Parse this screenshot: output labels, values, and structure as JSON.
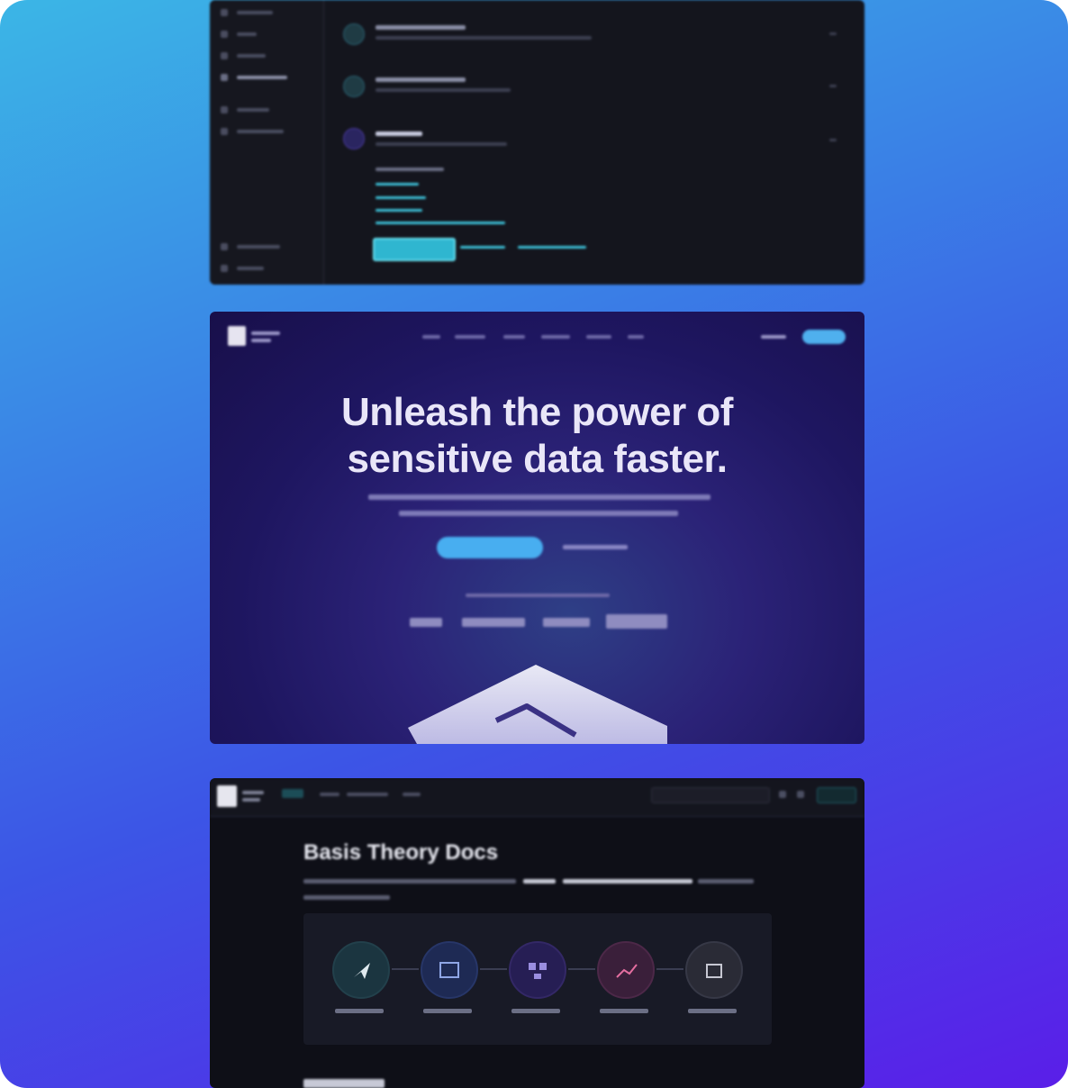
{
  "hero": {
    "title_line1": "Unleash the power of",
    "title_line2": "sensitive data faster."
  },
  "docs": {
    "title": "Basis Theory Docs"
  },
  "colors": {
    "background_top": "#3bb6e6",
    "background_bottom": "#5a1ee8",
    "accent_cyan": "#3cc0d8",
    "panel_dark": "#14151d"
  },
  "icons": [
    "rocket-icon",
    "inbox-icon",
    "stages-icon",
    "chart-icon",
    "box-icon"
  ]
}
